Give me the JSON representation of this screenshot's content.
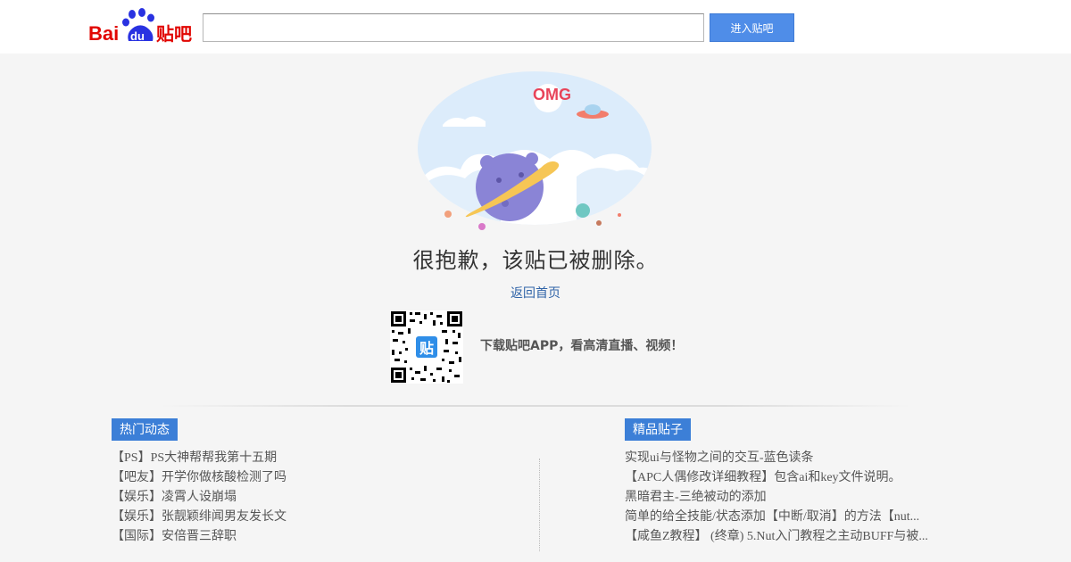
{
  "header": {
    "logo": {
      "text_bai": "Bai",
      "text_du": "du",
      "text_tieba": "贴吧"
    },
    "search": {
      "value": "",
      "placeholder": ""
    },
    "enter_button_label": "进入贴吧"
  },
  "illustration": {
    "text": "OMG",
    "icon": "planet-ufo-illustration"
  },
  "main": {
    "message": "很抱歉，该贴已被删除。",
    "home_link": "返回首页",
    "download_text": "下载贴吧APP，看高清直播、视频！",
    "qr_center_text": "贴"
  },
  "hot_section": {
    "title": "热门动态",
    "items": [
      "【PS】PS大神帮帮我第十五期",
      "【吧友】开学你做核酸检测了吗",
      "【娱乐】凌霄人设崩塌",
      "【娱乐】张靓颖绯闻男友发长文",
      "【国际】安倍晋三辞职"
    ]
  },
  "good_section": {
    "title": "精品贴子",
    "items": [
      "实现ui与怪物之间的交互-蓝色读条",
      "【APC人偶修改详细教程】包含ai和key文件说明。",
      "黑暗君主-三绝被动的添加",
      "简单的给全技能/状态添加【中断/取消】的方法【nut...",
      "【咸鱼Z教程】 (终章) 5.Nut入门教程之主动BUFF与被..."
    ]
  },
  "colors": {
    "accent": "#4f8de8",
    "section_title_bg": "#3c7fd7",
    "link": "#3064a8",
    "logo_red": "#e10602",
    "logo_blue": "#2932e1"
  }
}
